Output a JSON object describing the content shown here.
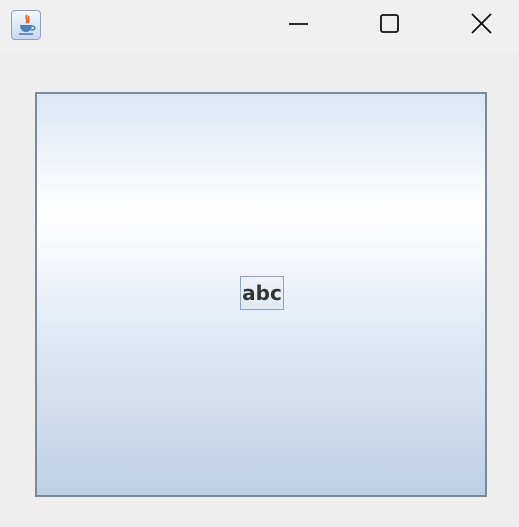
{
  "window": {
    "title": "",
    "icon": "java-cup-icon",
    "controls": [
      "minimize-icon",
      "maximize-icon",
      "close-icon"
    ]
  },
  "panel": {
    "button_label": "abc"
  }
}
